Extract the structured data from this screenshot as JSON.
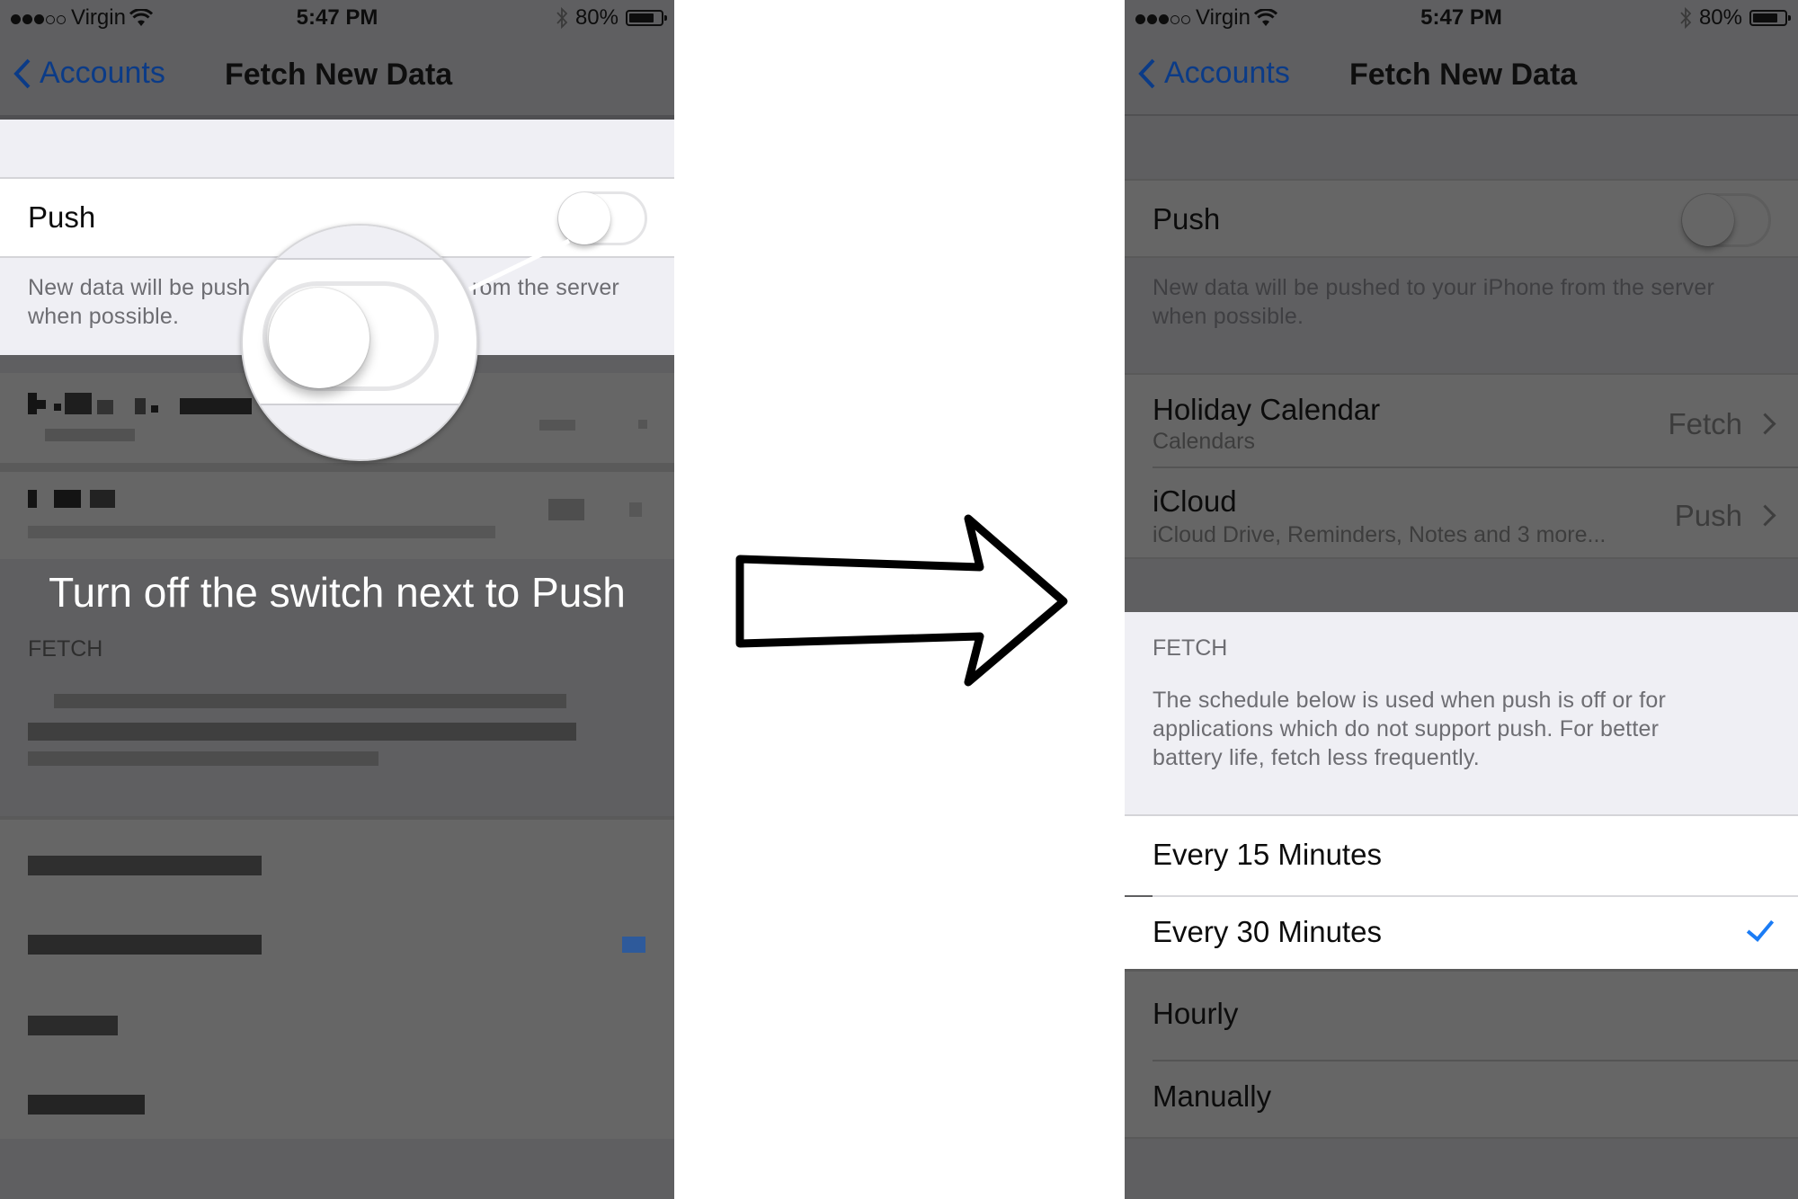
{
  "status_bar": {
    "signal_filled": 3,
    "signal_total": 5,
    "carrier": "Virgin",
    "time": "5:47 PM",
    "battery_percent_label": "80%",
    "battery_level": 0.8
  },
  "nav": {
    "back_label": "Accounts",
    "title": "Fetch New Data"
  },
  "colors": {
    "accent_blue": "#1b7cf5",
    "back_link_dimmed": "#0b3b87"
  },
  "left_panel": {
    "push_label": "Push",
    "push_enabled": false,
    "push_footer_visible": "New data will be push",
    "push_footer_visible_right": "rom the server",
    "push_footer_line2": "when possible.",
    "instruction": "Turn off the switch next to Push",
    "fetch_header": "FETCH"
  },
  "right_panel": {
    "push_label": "Push",
    "push_enabled": false,
    "push_footer": "New data will be pushed to your iPhone from the server when possible.",
    "accounts": [
      {
        "name": "Holiday Calendar",
        "subtitle": "Calendars",
        "mode": "Fetch"
      },
      {
        "name": "iCloud",
        "subtitle": "iCloud Drive, Reminders, Notes and 3 more...",
        "mode": "Push"
      }
    ],
    "fetch_header": "FETCH",
    "fetch_description": "The schedule below is used when push is off or for applications which do not support push. For better battery life, fetch less frequently.",
    "fetch_options": [
      {
        "label": "Every 15 Minutes",
        "selected": false
      },
      {
        "label": "Every 30 Minutes",
        "selected": true
      },
      {
        "label": "Hourly",
        "selected": false
      },
      {
        "label": "Manually",
        "selected": false
      }
    ]
  }
}
